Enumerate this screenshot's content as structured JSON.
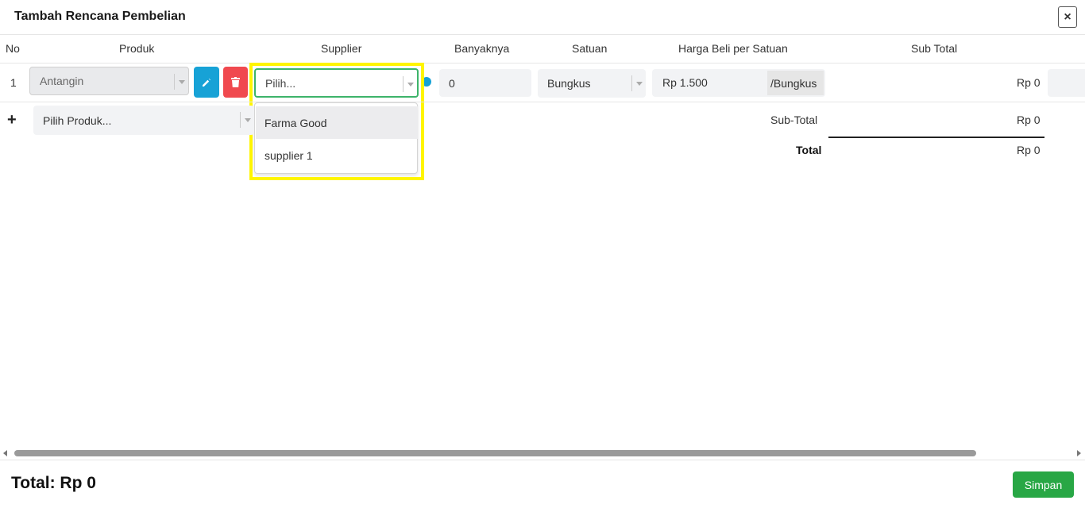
{
  "modal": {
    "title": "Tambah Rencana Pembelian",
    "close_label": "×"
  },
  "columns": [
    "No",
    "Produk",
    "Supplier",
    "Banyaknya",
    "Satuan",
    "Harga Beli per Satuan",
    "Sub Total"
  ],
  "row": {
    "no": "1",
    "product": "Antangin",
    "supplier_placeholder": "Pilih...",
    "quantity": "0",
    "unit": "Bungkus",
    "price": "Rp 1.500",
    "price_unit": "/Bungkus",
    "subtotal": "Rp 0"
  },
  "supplier_options": [
    "Farma Good",
    "supplier 1"
  ],
  "add_row": {
    "icon": "+",
    "placeholder": "Pilih Produk..."
  },
  "summary": {
    "subtotal_label": "Sub-Total",
    "subtotal_value": "Rp 0",
    "total_label": "Total",
    "total_value": "Rp 0"
  },
  "footer": {
    "total_text": "Total: Rp 0",
    "save_label": "Simpan"
  },
  "colors": {
    "edit_button": "#17a2d6",
    "delete_button": "#f0494f",
    "save_button": "#28a745",
    "focus_border": "#3db46a",
    "highlight": "#fff500"
  },
  "icons": {
    "edit": "pencil-icon",
    "delete": "trash-icon",
    "add": "plus-icon",
    "close": "close-icon"
  }
}
